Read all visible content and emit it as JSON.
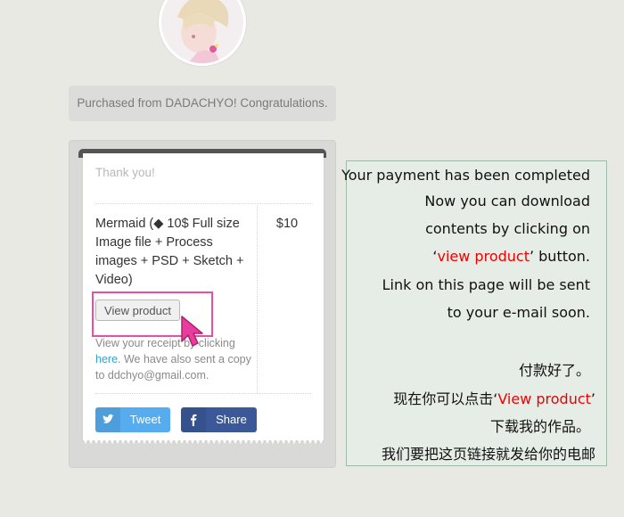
{
  "notice": "Purchased from DADACHYO! Congratulations.",
  "receipt": {
    "thanks": "Thank you!",
    "item_name": "Mermaid (◆ 10$ Full size Image file + Process images + PSD + Sketch + Video)",
    "price": "$10",
    "view_button": "View product",
    "note_before": "View your receipt by clicking ",
    "note_link": "here",
    "note_after": ". We have also sent a copy to ddchyo@gmail.com.",
    "tweet_label": "Tweet",
    "share_label": "Share",
    "tweet_icon": "twitter-bird-icon",
    "share_icon": "facebook-f-icon"
  },
  "info": {
    "en_line1": "Your payment has been completed",
    "en_line2": "Now you can download",
    "en_line3": "contents by clicking on",
    "en_line4_open": "‘",
    "en_line4_red": "view product",
    "en_line4_close": "’ button.",
    "en_line5": "Link on this page will be sent",
    "en_line6": "to your e-mail soon.",
    "zh_line1": "付款好了。",
    "zh_line2_pre": "现在你可以点击‘",
    "zh_line2_red": "View product",
    "zh_line2_post": "’",
    "zh_line3": "下载我的作品。",
    "zh_line4": "我们要把这页链接就发给你的电邮"
  },
  "colors": {
    "background": "#e8e9e3",
    "highlight": "#e64fa2",
    "link": "#3a9fc9",
    "tweet": "#55acee",
    "share": "#3b5998",
    "accent_red": "#e00000"
  }
}
